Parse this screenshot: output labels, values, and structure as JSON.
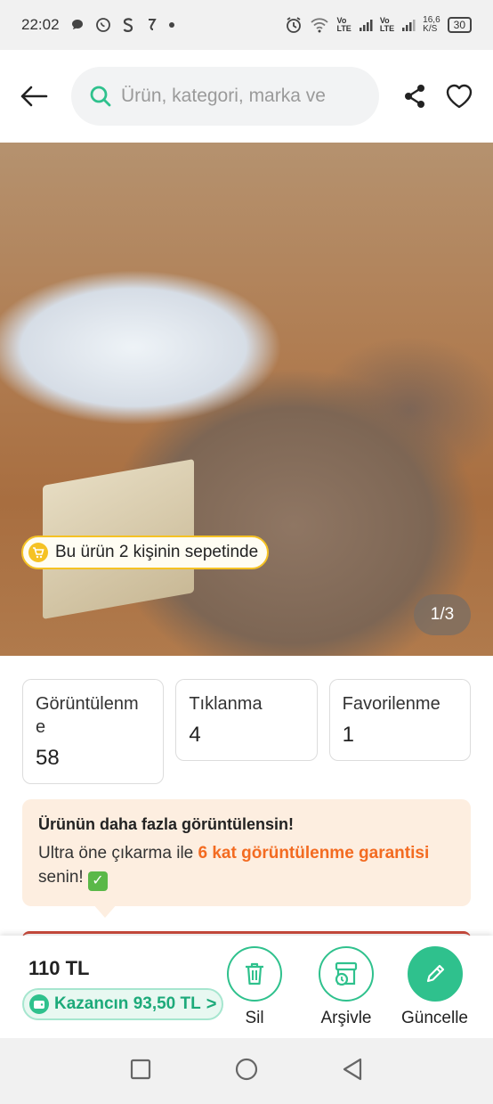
{
  "status_bar": {
    "time": "22:02",
    "icons": [
      "chat-icon",
      "whatsapp-icon",
      "s-icon",
      "j-icon",
      "dot-icon"
    ],
    "right_icons": [
      "alarm-icon",
      "wifi-icon",
      "volte-icon",
      "signal-icon"
    ],
    "volte_1": "Vo\nLTE",
    "volte_2": "Vo\nLTE",
    "speed": "16,6\nK/S",
    "battery": "30"
  },
  "header": {
    "search_placeholder": "Ürün, kategori, marka ve"
  },
  "product_image": {
    "cart_badge": "Bu ürün 2 kişinin sepetinde",
    "pager": "1/3"
  },
  "stats": [
    {
      "label": "Görüntülenme",
      "value": "58"
    },
    {
      "label": "Tıklanma",
      "value": "4"
    },
    {
      "label": "Favorilenme",
      "value": "1"
    }
  ],
  "promo": {
    "title": "Ürünün daha fazla görüntülensin!",
    "text_before": "Ultra öne çıkarma ile ",
    "highlight": "6 kat görüntülenme garantisi",
    "text_after": " senin! ",
    "check": "✓"
  },
  "bottom_bar": {
    "price": "110 TL",
    "earnings": "Kazancın 93,50 TL",
    "earnings_chevron": ">",
    "actions": [
      {
        "label": "Sil",
        "icon": "trash-icon"
      },
      {
        "label": "Arşivle",
        "icon": "archive-icon"
      },
      {
        "label": "Güncelle",
        "icon": "pencil-icon"
      }
    ]
  },
  "colors": {
    "accent": "#2fc18d",
    "highlight": "#f36b21",
    "badge_border": "#f5c224",
    "promo_bg": "#fdeee0"
  }
}
